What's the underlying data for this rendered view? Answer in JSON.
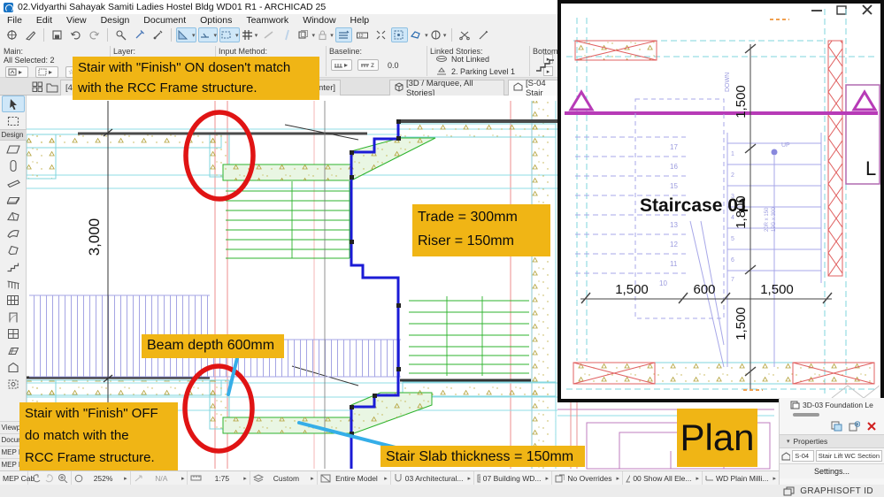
{
  "window": {
    "title": "02.Vidyarthi Sahayak Samiti Ladies Hostel Bldg WD01 R1 - ARCHICAD 25",
    "menus": [
      "File",
      "Edit",
      "View",
      "Design",
      "Document",
      "Options",
      "Teamwork",
      "Window",
      "Help"
    ]
  },
  "toolbar_icon_names": [
    "zoom-extents",
    "annotate",
    "save",
    "undo",
    "redo",
    "select-arrow",
    "offset-tool",
    "marquee-offset",
    "grid-snap",
    "guide-line",
    "guide-segment",
    "copy-box",
    "lock",
    "stories",
    "dimension-tool",
    "fit-view",
    "rotate-tool",
    "boolean-tool",
    "favorites",
    "circle-tool",
    "scissors",
    "magic-wand"
  ],
  "info_bar": {
    "main_label": "Main:",
    "selected": "All Selected: 2",
    "layer_label": "Layer:",
    "input_method_label": "Input Method:",
    "baseline_label": "Baseline:",
    "baseline_value": "0.0",
    "linked_stories_label": "Linked Stories:",
    "not_linked": "Not Linked",
    "parking": "2. Parking Level 1",
    "bottom_label": "Bottom"
  },
  "tabs": {
    "tab1_start": "[4. F",
    "tab1_end": "nter]",
    "tab2": "[3D / Marquee, All Stories]",
    "tab3": "[S-04 Stair"
  },
  "toolbox": {
    "design_label": "Design",
    "tools": [
      "arrow",
      "marquee",
      "wall",
      "column",
      "beam",
      "slab",
      "roof",
      "shell",
      "stair",
      "railing",
      "curtain-wall",
      "door",
      "window",
      "skylight",
      "object",
      "zone"
    ],
    "groups": [
      "Viewpo",
      "Docum",
      "MEP D",
      "MEP Pi",
      "MEP Cab"
    ]
  },
  "annotations": {
    "note_top_line1": "Stair with \"Finish\" ON dosen't match",
    "note_top_line2": "with the RCC Frame structure.",
    "trade": "Trade = 300mm",
    "riser": "Riser = 150mm",
    "beam_depth": "Beam depth 600mm",
    "note_bottom_line1": "Stair with \"Finish\" OFF",
    "note_bottom_line2": "do match with the",
    "note_bottom_line3": "RCC Frame structure.",
    "slab_thickness": "Stair Slab thickness = 150mm",
    "plan_label": "Plan"
  },
  "section": {
    "dim_3000": "3,000"
  },
  "inset": {
    "title": "Staircase 01",
    "dim_v1": "1,500",
    "dim_v2": "1,800",
    "dim_v3": "1,500",
    "dim_h1": "1,500",
    "dim_h2": "600",
    "dim_h3": "1,500",
    "up": "UP",
    "down": "DOWN",
    "lift_letter": "L",
    "riser_note1": "20R x 150",
    "riser_note2": "19G x 300",
    "treads_left": [
      "17",
      "16",
      "15",
      "13",
      "12",
      "11",
      "10"
    ],
    "treads_right": [
      "1",
      "2",
      "3",
      "4",
      "5",
      "6",
      "7"
    ]
  },
  "right_panel": {
    "viewpoint": "3D-03 Foundation Le",
    "properties_label": "Properties",
    "id_value": "S-04",
    "name_value": "Stair Lift WC Section",
    "settings_label": "Settings..."
  },
  "status_bar": {
    "zoom": "252%",
    "orientation": "N/A",
    "scale": "1:75",
    "layer_combo": "Custom",
    "model_filter": "Entire Model",
    "pen_set": "03 Architectural...",
    "layout": "07 Building WD...",
    "overrides": "No Overrides",
    "show": "00 Show All Ele...",
    "dim_style": "WD Plain Milli...",
    "settings": "Settings...",
    "graphisoft": "GRAPHISOFT ID"
  },
  "colors": {
    "annotation_yellow": "#f0b515",
    "selection_blue": "#1b1bd6",
    "stair_green": "#2db32d",
    "grid_red": "#f0a0a0",
    "slab_cyan": "#7fd4de",
    "section_magenta": "#b73bb7",
    "markup_red": "#e01414",
    "leader_cyan": "#35aee8",
    "hatch_lavender": "#9e9ee0"
  }
}
